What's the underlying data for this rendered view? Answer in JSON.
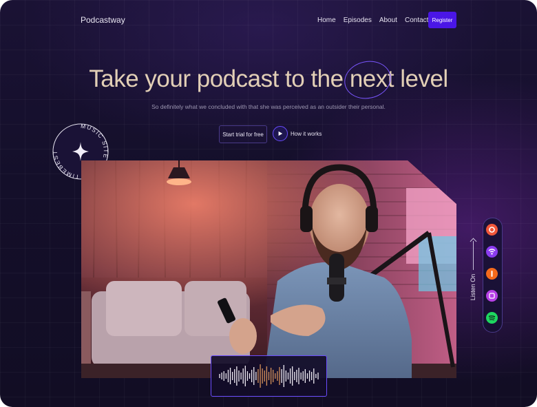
{
  "nav": {
    "logo": "Podcastway",
    "items": [
      "Home",
      "Episodes",
      "About",
      "Contact"
    ],
    "register_label": "Register"
  },
  "hero": {
    "title_before": "Take your podcast to the ",
    "title_highlight": "next",
    "title_after": " level",
    "subtitle": "So definitely what we concluded with that she was perceived as an outsider their personal.",
    "trial_label": "Start trial for free",
    "how_label": "How it works"
  },
  "badge": {
    "text": "MUSIC SITE OF ALL TIMEBEST"
  },
  "listen": {
    "label": "Listen On",
    "platforms": [
      "podcast-app-icon",
      "wifi-podcast-icon",
      "castbox-icon",
      "google-podcasts-icon",
      "spotify-icon"
    ]
  },
  "colors": {
    "accent": "#4a16e6",
    "title": "#e2cfb6",
    "background": "#140f2a",
    "wave_white": "#f2eef6",
    "wave_orange": "#d6915a"
  }
}
